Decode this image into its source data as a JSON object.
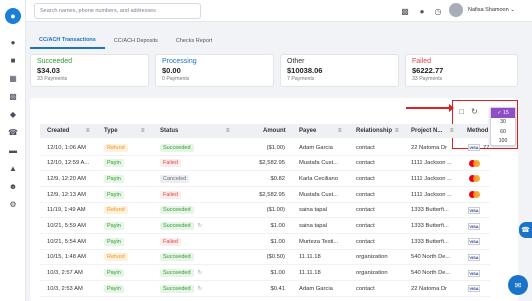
{
  "search": {
    "placeholder": "Search names, phone numbers, and addresses"
  },
  "user": {
    "name": "Nafisa Shamoon",
    "chevron": "⌄"
  },
  "tabs": [
    {
      "label": "CC/ACH Transactions"
    },
    {
      "label": "CC/ACH Deposits"
    },
    {
      "label": "Checks Report"
    }
  ],
  "summary": [
    {
      "label": "Succeeded",
      "amount": "$34.03",
      "count": "33 Payments",
      "color": "#2f9b34"
    },
    {
      "label": "Processing",
      "amount": "$0.00",
      "count": "0 Payments",
      "color": "#1a73c8"
    },
    {
      "label": "Other",
      "amount": "$10038.06",
      "count": "7 Payments",
      "color": "#333333"
    },
    {
      "label": "Failed",
      "amount": "$6222.77",
      "count": "33 Payments",
      "color": "#e04545"
    }
  ],
  "page_size": {
    "options": [
      "15",
      "30",
      "60",
      "100"
    ],
    "selected": "15",
    "check": "✓"
  },
  "table": {
    "headers": {
      "created": "Created",
      "type": "Type",
      "status": "Status",
      "amount": "Amount",
      "payee": "Payee",
      "relationship": "Relationship",
      "project": "Project N...",
      "method": "Method"
    },
    "rows": [
      {
        "created": "12/10, 1:06 AM",
        "type": "Refund",
        "status": "Succeeded",
        "reload": false,
        "amount": "($1.00)",
        "payee": "Adam Garcia",
        "relationship": "contact",
        "project": "22 Natoma Dr",
        "method": "visa",
        "extra": "77"
      },
      {
        "created": "12/10, 12:59 A...",
        "type": "Payin",
        "status": "Failed",
        "reload": false,
        "amount": "$2,582.95",
        "payee": "Mustafa Cust...",
        "relationship": "contact",
        "project": "1111 Jackson ...",
        "method": "mastercard",
        "extra": ""
      },
      {
        "created": "12/9, 12:20 AM",
        "type": "Payin",
        "status": "Canceled",
        "reload": false,
        "amount": "$0.82",
        "payee": "Karla Ceciliano",
        "relationship": "contact",
        "project": "1111 Jackson ...",
        "method": "mastercard",
        "extra": ""
      },
      {
        "created": "12/9, 12:13 AM",
        "type": "Payin",
        "status": "Failed",
        "reload": false,
        "amount": "$2,582.95",
        "payee": "Mustafa Cust...",
        "relationship": "contact",
        "project": "1111 Jackson ...",
        "method": "mastercard",
        "extra": ""
      },
      {
        "created": "11/19, 1:49 AM",
        "type": "Refund",
        "status": "Succeeded",
        "reload": false,
        "amount": "($1.00)",
        "payee": "saina tapal",
        "relationship": "contact",
        "project": "1333 Butterfi...",
        "method": "visa",
        "extra": ""
      },
      {
        "created": "10/21, 5:59 AM",
        "type": "Payin",
        "status": "Succeeded",
        "reload": true,
        "amount": "$1.00",
        "payee": "saina tapal",
        "relationship": "contact",
        "project": "1333 Butterfi...",
        "method": "visa",
        "extra": ""
      },
      {
        "created": "10/21, 5:54 AM",
        "type": "Payin",
        "status": "Failed",
        "reload": false,
        "amount": "$1.00",
        "payee": "Murteza Testi...",
        "relationship": "contact",
        "project": "1333 Butterfi...",
        "method": "visa",
        "extra": ""
      },
      {
        "created": "10/15, 1:48 AM",
        "type": "Refund",
        "status": "Succeeded",
        "reload": false,
        "amount": "($0.50)",
        "payee": "11.11.18",
        "relationship": "organization",
        "project": "540 North De...",
        "method": "visa",
        "extra": ""
      },
      {
        "created": "10/3, 2:57 AM",
        "type": "Payin",
        "status": "Succeeded",
        "reload": true,
        "amount": "$1.00",
        "payee": "11.11.18",
        "relationship": "organization",
        "project": "540 North De...",
        "method": "visa",
        "extra": ""
      },
      {
        "created": "10/3, 2:53 AM",
        "type": "Payin",
        "status": "Succeeded",
        "reload": true,
        "amount": "$0.41",
        "payee": "Adam Garcia",
        "relationship": "contact",
        "project": "22 Natoma Dr",
        "method": "visa",
        "extra": ""
      }
    ]
  },
  "icons": {
    "logo": "logo-icon",
    "visa_text": "VISA"
  }
}
